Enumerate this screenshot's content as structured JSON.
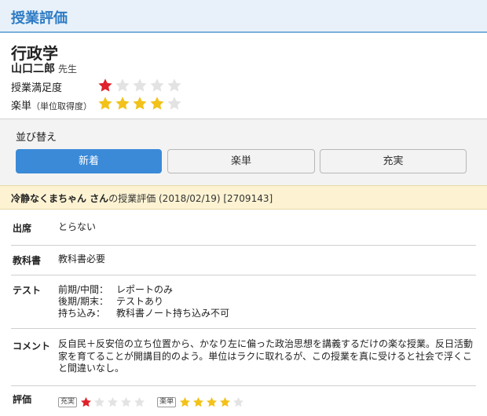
{
  "header": {
    "title": "授業評価"
  },
  "course": {
    "name": "行政学",
    "teacher": "山口二郎",
    "teacher_suffix": "先生",
    "satisfaction": {
      "label": "授業満足度",
      "value": 1,
      "max": 5,
      "color": "#e0202a"
    },
    "easiness": {
      "label": "楽単",
      "label_sub": "（単位取得度）",
      "value": 4,
      "max": 5,
      "color": "#f2c21a"
    }
  },
  "sort": {
    "title": "並び替え",
    "options": [
      {
        "label": "新着",
        "active": true
      },
      {
        "label": "楽単",
        "active": false
      },
      {
        "label": "充実",
        "active": false
      }
    ]
  },
  "review": {
    "author": "冷静なくまちゃん さん",
    "suffix_text": "の授業評価 (2018/02/19) [2709143]",
    "attendance": {
      "label": "出席",
      "value": "とらない"
    },
    "textbook": {
      "label": "教科書",
      "value": "教科書必要"
    },
    "test": {
      "label": "テスト",
      "lines": [
        {
          "key": "前期/中間：",
          "value": "レポートのみ"
        },
        {
          "key": "後期/期末：",
          "value": "テストあり"
        },
        {
          "key": "持ち込み：",
          "value": "教科書ノート持ち込み不可"
        }
      ]
    },
    "comment": {
      "label": "コメント",
      "value": "反自民＋反安倍の立ち位置から、かなり左に偏った政治思想を講義するだけの楽な授業。反日活動家を育てることが開講目的のよう。単位はラクに取れるが、この授業を真に受けると社会で浮くこと間違いなし。"
    },
    "evaluation": {
      "label": "評価",
      "fulfillment": {
        "tag": "充実",
        "value": 1,
        "max": 5,
        "color": "#e0202a"
      },
      "easiness": {
        "tag": "楽単",
        "value": 4,
        "max": 5,
        "color": "#f2c21a"
      }
    }
  },
  "colors": {
    "accent": "#3b8ad8",
    "header_bg": "#e8f1fa",
    "review_header_bg": "#fdf3d3",
    "star_empty": "#e3e3e3"
  }
}
